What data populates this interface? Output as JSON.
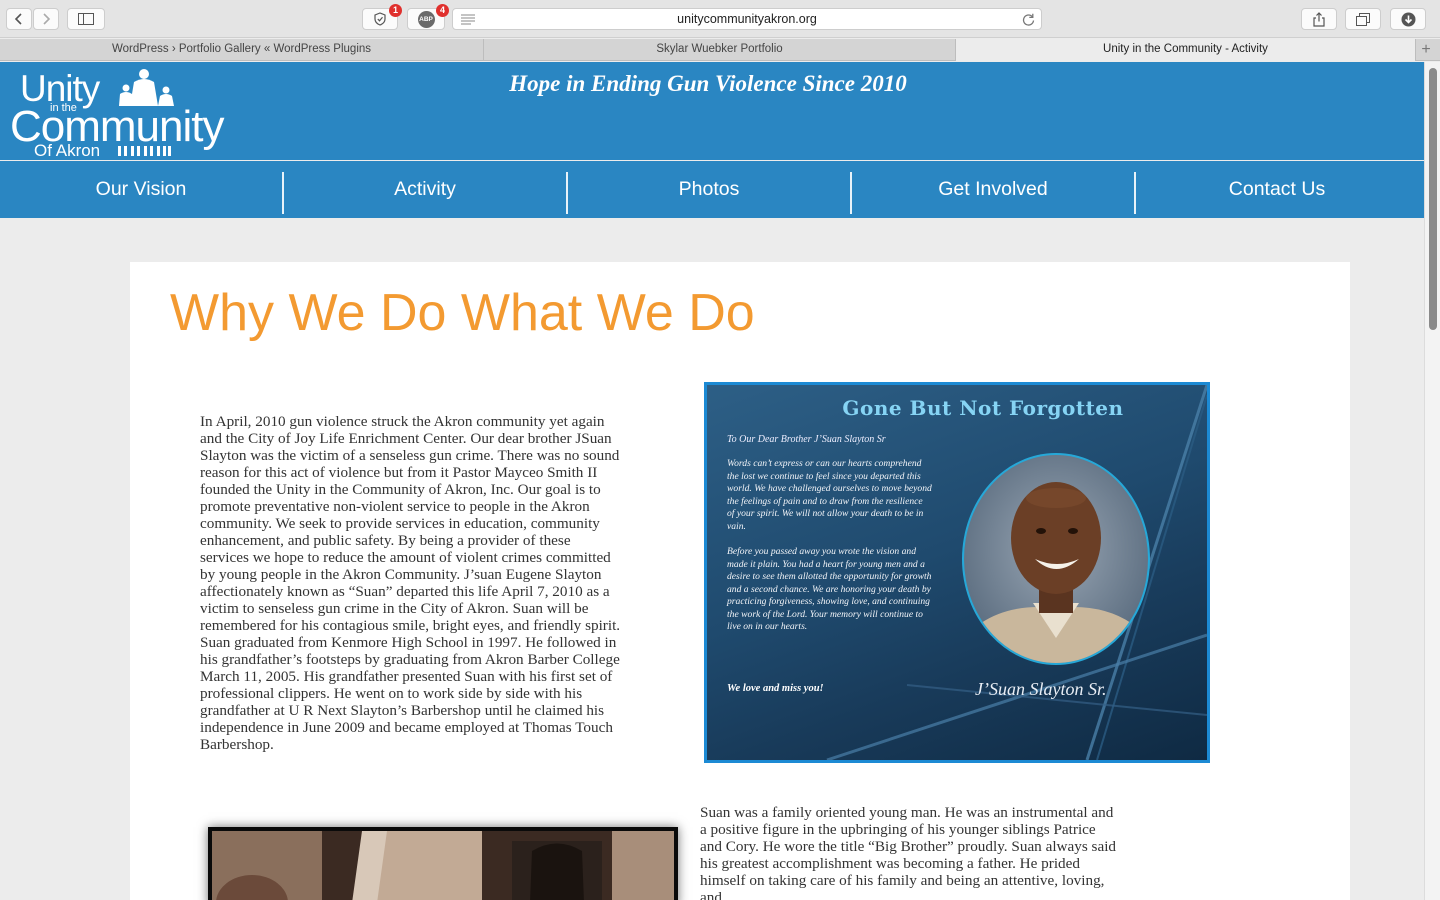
{
  "browser": {
    "url": "unitycommunityakron.org",
    "privacy_badge": "1",
    "adblock_label": "ABP",
    "adblock_badge": "4",
    "tabs": [
      {
        "title": "WordPress › Portfolio Gallery « WordPress Plugins",
        "active": false
      },
      {
        "title": "Skylar Wuebker Portfolio",
        "active": false
      },
      {
        "title": "Unity in the Community - Activity",
        "active": true
      }
    ],
    "icons": {
      "back": "chevron-left-icon",
      "forward": "chevron-right-icon",
      "sidebar": "sidebar-icon",
      "privacy": "shield-icon",
      "reader": "reader-icon",
      "reload": "reload-icon",
      "share": "share-icon",
      "tabs": "tabs-overview-icon",
      "download": "download-icon",
      "new_tab": "plus-icon"
    }
  },
  "site": {
    "logo": {
      "line1": "Unity",
      "line2": "in the",
      "line3": "Community",
      "line4": "Of Akron"
    },
    "tagline": "Hope in Ending Gun Violence Since 2010",
    "nav": [
      {
        "label": "Our Vision"
      },
      {
        "label": "Activity"
      },
      {
        "label": "Photos"
      },
      {
        "label": "Get Involved"
      },
      {
        "label": "Contact Us"
      }
    ],
    "colors": {
      "header_blue": "#2a86c2",
      "title_orange": "#f39a31",
      "image_border": "#1c8ad4"
    }
  },
  "main": {
    "title": "Why We Do What We Do",
    "paragraph1": "In April, 2010 gun violence struck the Akron community yet again and the City of Joy Life Enrichment Center. Our dear brother JSuan Slayton was the victim of a senseless gun crime. There was no sound reason for this act of violence but from it Pastor Mayceo Smith II founded the Unity in the Community of Akron, Inc. Our goal is to promote preventative non-violent service to people in the Akron community. We seek to provide services in education, community enhancement, and public safety. By being a provider of these services we hope to reduce the amount of violent crimes committed by young people in the Akron Community. J’suan Eugene Slayton affectionately known as “Suan” departed this life April 7, 2010 as a victim to senseless gun crime in the City of Akron. Suan will be remembered for his contagious smile, bright eyes, and friendly spirit.",
    "paragraph2": "Suan graduated from Kenmore High School in 1997. He followed in his grandfather’s footsteps by graduating from Akron Barber College March 11, 2005. His grandfather presented Suan with his first set of professional clippers. He went on to work side by side with his grandfather at U R Next Slayton’s Barbershop until he claimed his independence in June 2009 and became employed at Thomas Touch Barbershop.",
    "paragraph3": "Suan was a family oriented young man. He was an instrumental and a positive figure in the upbringing of his younger siblings Patrice and Cory. He wore the title “Big Brother” proudly. Suan always said his greatest accomplishment was becoming a father. He prided himself on taking care of his family and being an attentive, loving, and",
    "memorial": {
      "title": "Gone But Not Forgotten",
      "greeting": "To Our Dear Brother J’Suan Slayton Sr",
      "body1": "Words can’t express or can our hearts comprehend the lost we continue to feel since you departed this world. We have challenged ourselves to move beyond the feelings of pain and to draw from the resilience of your spirit. We will not allow your death to be in vain.",
      "body2": "Before you passed away you wrote the vision and made it plain. You had a heart for young men and a desire to see them allotted the opportunity for growth and a second chance. We are honoring your death by practicing forgiveness, showing love, and continuing the work of the Lord. Your memory will continue to live on in our hearts.",
      "closing": "We love and miss you!",
      "signature": "J’Suan Slayton Sr."
    }
  }
}
